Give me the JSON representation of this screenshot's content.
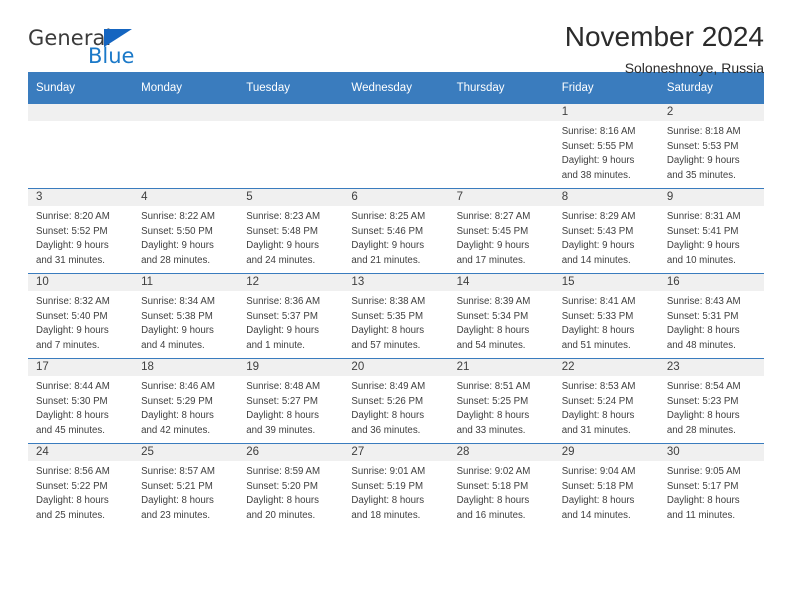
{
  "brand": {
    "name_part1": "General",
    "name_part2": "Blue",
    "triangle_color": "#1565c0",
    "blue_color": "#1b79c8"
  },
  "header": {
    "title": "November 2024",
    "subtitle": "Soloneshnoye, Russia"
  },
  "theme": {
    "header_bg": "#3a7cbe",
    "daynum_bg": "#f0f0f0",
    "text": "#3f3f3f"
  },
  "weekday_headers": [
    "Sunday",
    "Monday",
    "Tuesday",
    "Wednesday",
    "Thursday",
    "Friday",
    "Saturday"
  ],
  "weeks": [
    [
      {
        "day": "",
        "lines": []
      },
      {
        "day": "",
        "lines": []
      },
      {
        "day": "",
        "lines": []
      },
      {
        "day": "",
        "lines": []
      },
      {
        "day": "",
        "lines": []
      },
      {
        "day": "1",
        "lines": [
          "Sunrise: 8:16 AM",
          "Sunset: 5:55 PM",
          "Daylight: 9 hours",
          "and 38 minutes."
        ]
      },
      {
        "day": "2",
        "lines": [
          "Sunrise: 8:18 AM",
          "Sunset: 5:53 PM",
          "Daylight: 9 hours",
          "and 35 minutes."
        ]
      }
    ],
    [
      {
        "day": "3",
        "lines": [
          "Sunrise: 8:20 AM",
          "Sunset: 5:52 PM",
          "Daylight: 9 hours",
          "and 31 minutes."
        ]
      },
      {
        "day": "4",
        "lines": [
          "Sunrise: 8:22 AM",
          "Sunset: 5:50 PM",
          "Daylight: 9 hours",
          "and 28 minutes."
        ]
      },
      {
        "day": "5",
        "lines": [
          "Sunrise: 8:23 AM",
          "Sunset: 5:48 PM",
          "Daylight: 9 hours",
          "and 24 minutes."
        ]
      },
      {
        "day": "6",
        "lines": [
          "Sunrise: 8:25 AM",
          "Sunset: 5:46 PM",
          "Daylight: 9 hours",
          "and 21 minutes."
        ]
      },
      {
        "day": "7",
        "lines": [
          "Sunrise: 8:27 AM",
          "Sunset: 5:45 PM",
          "Daylight: 9 hours",
          "and 17 minutes."
        ]
      },
      {
        "day": "8",
        "lines": [
          "Sunrise: 8:29 AM",
          "Sunset: 5:43 PM",
          "Daylight: 9 hours",
          "and 14 minutes."
        ]
      },
      {
        "day": "9",
        "lines": [
          "Sunrise: 8:31 AM",
          "Sunset: 5:41 PM",
          "Daylight: 9 hours",
          "and 10 minutes."
        ]
      }
    ],
    [
      {
        "day": "10",
        "lines": [
          "Sunrise: 8:32 AM",
          "Sunset: 5:40 PM",
          "Daylight: 9 hours",
          "and 7 minutes."
        ]
      },
      {
        "day": "11",
        "lines": [
          "Sunrise: 8:34 AM",
          "Sunset: 5:38 PM",
          "Daylight: 9 hours",
          "and 4 minutes."
        ]
      },
      {
        "day": "12",
        "lines": [
          "Sunrise: 8:36 AM",
          "Sunset: 5:37 PM",
          "Daylight: 9 hours",
          "and 1 minute."
        ]
      },
      {
        "day": "13",
        "lines": [
          "Sunrise: 8:38 AM",
          "Sunset: 5:35 PM",
          "Daylight: 8 hours",
          "and 57 minutes."
        ]
      },
      {
        "day": "14",
        "lines": [
          "Sunrise: 8:39 AM",
          "Sunset: 5:34 PM",
          "Daylight: 8 hours",
          "and 54 minutes."
        ]
      },
      {
        "day": "15",
        "lines": [
          "Sunrise: 8:41 AM",
          "Sunset: 5:33 PM",
          "Daylight: 8 hours",
          "and 51 minutes."
        ]
      },
      {
        "day": "16",
        "lines": [
          "Sunrise: 8:43 AM",
          "Sunset: 5:31 PM",
          "Daylight: 8 hours",
          "and 48 minutes."
        ]
      }
    ],
    [
      {
        "day": "17",
        "lines": [
          "Sunrise: 8:44 AM",
          "Sunset: 5:30 PM",
          "Daylight: 8 hours",
          "and 45 minutes."
        ]
      },
      {
        "day": "18",
        "lines": [
          "Sunrise: 8:46 AM",
          "Sunset: 5:29 PM",
          "Daylight: 8 hours",
          "and 42 minutes."
        ]
      },
      {
        "day": "19",
        "lines": [
          "Sunrise: 8:48 AM",
          "Sunset: 5:27 PM",
          "Daylight: 8 hours",
          "and 39 minutes."
        ]
      },
      {
        "day": "20",
        "lines": [
          "Sunrise: 8:49 AM",
          "Sunset: 5:26 PM",
          "Daylight: 8 hours",
          "and 36 minutes."
        ]
      },
      {
        "day": "21",
        "lines": [
          "Sunrise: 8:51 AM",
          "Sunset: 5:25 PM",
          "Daylight: 8 hours",
          "and 33 minutes."
        ]
      },
      {
        "day": "22",
        "lines": [
          "Sunrise: 8:53 AM",
          "Sunset: 5:24 PM",
          "Daylight: 8 hours",
          "and 31 minutes."
        ]
      },
      {
        "day": "23",
        "lines": [
          "Sunrise: 8:54 AM",
          "Sunset: 5:23 PM",
          "Daylight: 8 hours",
          "and 28 minutes."
        ]
      }
    ],
    [
      {
        "day": "24",
        "lines": [
          "Sunrise: 8:56 AM",
          "Sunset: 5:22 PM",
          "Daylight: 8 hours",
          "and 25 minutes."
        ]
      },
      {
        "day": "25",
        "lines": [
          "Sunrise: 8:57 AM",
          "Sunset: 5:21 PM",
          "Daylight: 8 hours",
          "and 23 minutes."
        ]
      },
      {
        "day": "26",
        "lines": [
          "Sunrise: 8:59 AM",
          "Sunset: 5:20 PM",
          "Daylight: 8 hours",
          "and 20 minutes."
        ]
      },
      {
        "day": "27",
        "lines": [
          "Sunrise: 9:01 AM",
          "Sunset: 5:19 PM",
          "Daylight: 8 hours",
          "and 18 minutes."
        ]
      },
      {
        "day": "28",
        "lines": [
          "Sunrise: 9:02 AM",
          "Sunset: 5:18 PM",
          "Daylight: 8 hours",
          "and 16 minutes."
        ]
      },
      {
        "day": "29",
        "lines": [
          "Sunrise: 9:04 AM",
          "Sunset: 5:18 PM",
          "Daylight: 8 hours",
          "and 14 minutes."
        ]
      },
      {
        "day": "30",
        "lines": [
          "Sunrise: 9:05 AM",
          "Sunset: 5:17 PM",
          "Daylight: 8 hours",
          "and 11 minutes."
        ]
      }
    ]
  ]
}
